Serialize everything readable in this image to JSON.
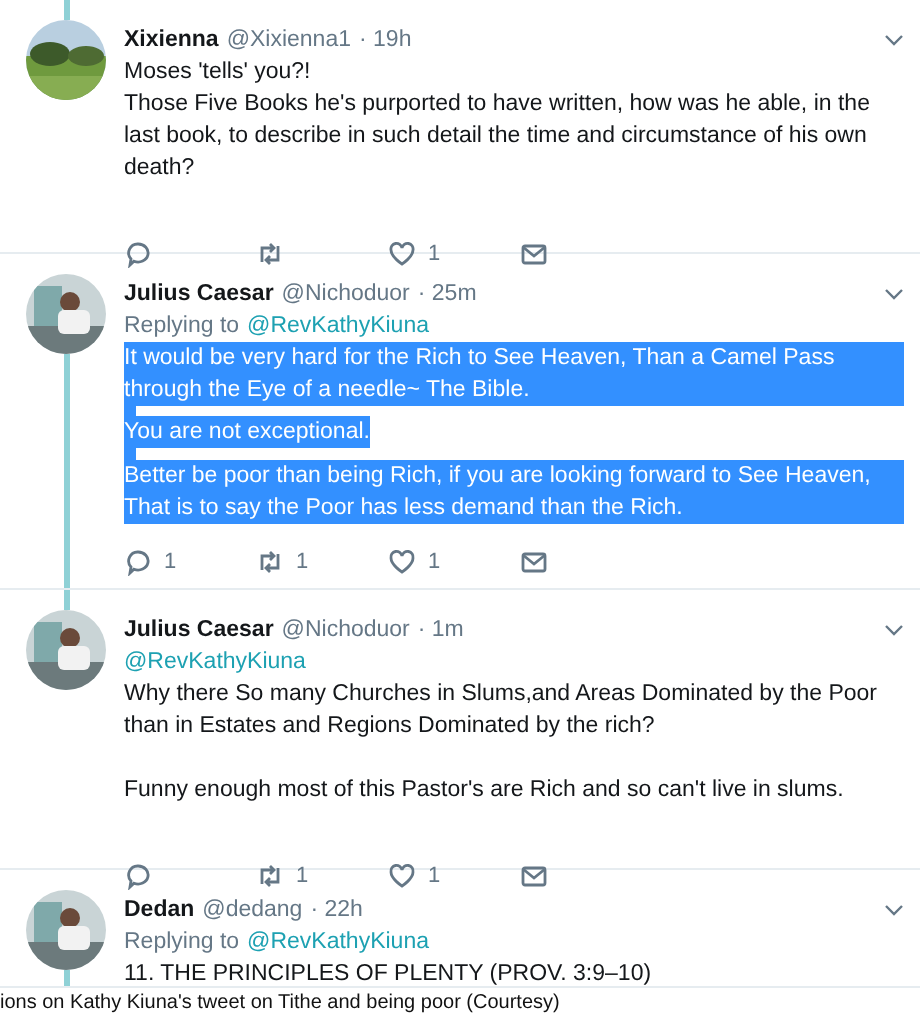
{
  "tweets": [
    {
      "name": "Xixienna",
      "handle": "@Xixienna1",
      "time": "· 19h",
      "thread_above": true,
      "thread_below": false,
      "paragraphs": [
        "Moses 'tells' you?!\nThose Five Books he's purported to have written,  how was he able, in the last book, to describe in such detail the time and circumstance of his own death?"
      ],
      "selected": false,
      "actions": [
        {
          "kind": "reply"
        },
        {
          "kind": "retweet"
        },
        {
          "kind": "like",
          "count": "1"
        },
        {
          "kind": "message"
        }
      ]
    },
    {
      "name": "Julius Caesar",
      "handle": "@Nichoduor",
      "time": "· 25m",
      "thread_above": false,
      "thread_below": true,
      "replying_label": "Replying to",
      "replying_to": "@RevKathyKiuna",
      "paragraphs": [
        "It would be very hard for the Rich to See Heaven, Than a Camel Pass through the Eye of a needle~ The Bible.",
        "You are not exceptional.",
        "Better be poor than being Rich, if you are looking forward to See Heaven, That is to say the Poor has less demand than the Rich."
      ],
      "selected": true,
      "actions": [
        {
          "kind": "reply",
          "count": "1"
        },
        {
          "kind": "retweet",
          "count": "1"
        },
        {
          "kind": "like",
          "count": "1"
        },
        {
          "kind": "message"
        }
      ]
    },
    {
      "name": "Julius Caesar",
      "handle": "@Nichoduor",
      "time": "· 1m",
      "thread_above": true,
      "thread_below": false,
      "mention": "@RevKathyKiuna",
      "paragraphs": [
        "Why there So many Churches in Slums,and Areas Dominated by the Poor than in Estates and Regions Dominated by the rich?",
        "Funny enough most of this Pastor's are Rich and so can't live in slums."
      ],
      "selected": false,
      "actions": [
        {
          "kind": "reply"
        },
        {
          "kind": "retweet",
          "count": "1"
        },
        {
          "kind": "like",
          "count": "1"
        },
        {
          "kind": "message"
        }
      ]
    },
    {
      "name": "Dedan",
      "handle": "@dedang",
      "time": "· 22h",
      "thread_above": false,
      "thread_below": true,
      "replying_label": "Replying to",
      "replying_to": "@RevKathyKiuna",
      "paragraphs": [
        "11. THE PRINCIPLES OF PLENTY (PROV. 3:9–10)"
      ],
      "selected": false
    }
  ],
  "caption": "ions on Kathy Kiuna's tweet on Tithe and being poor (Courtesy)"
}
